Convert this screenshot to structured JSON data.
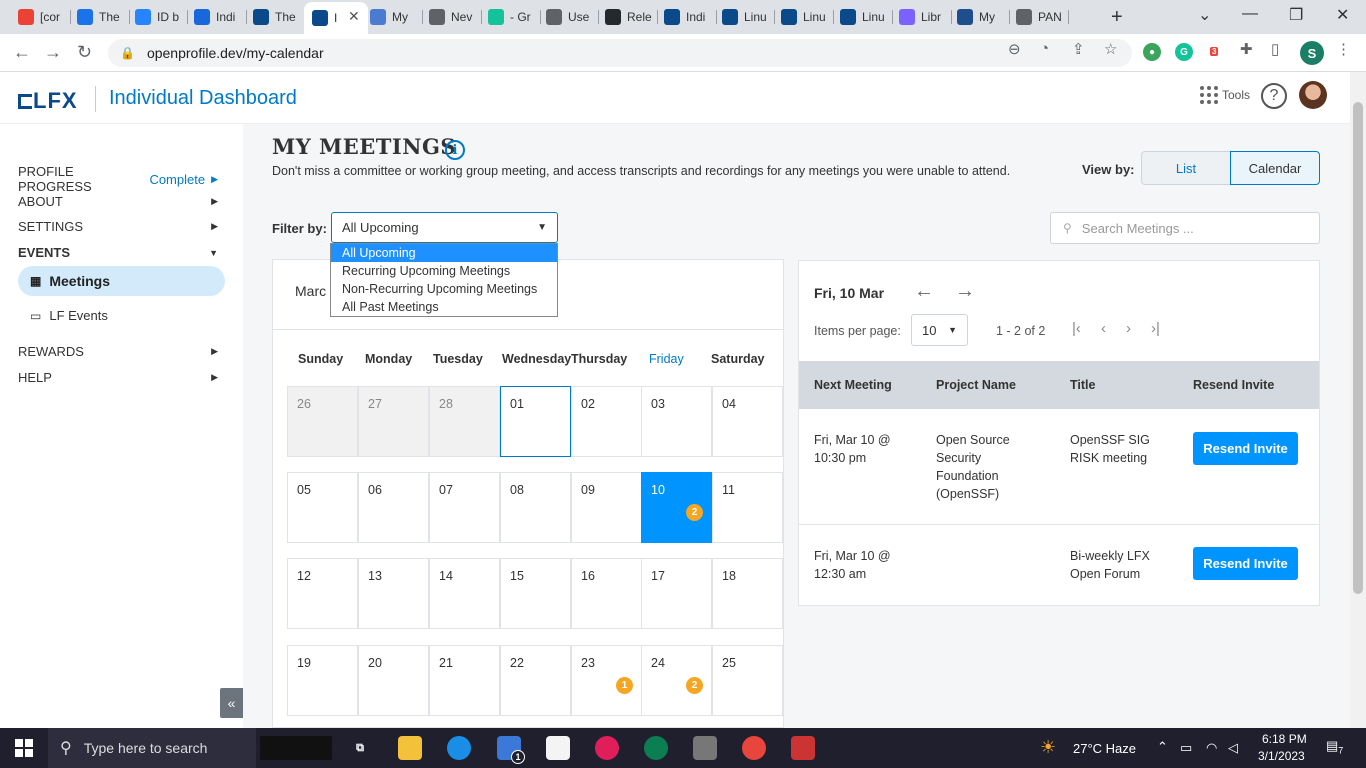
{
  "browser": {
    "tabs": [
      {
        "label": "[cor",
        "icon": "gmail-icon",
        "color": "#ea4335"
      },
      {
        "label": "The",
        "icon": "calendar-icon",
        "color": "#1a73e8"
      },
      {
        "label": "ID b",
        "icon": "jira-icon",
        "color": "#2684ff"
      },
      {
        "label": "Indi",
        "icon": "confluence-icon",
        "color": "#1868db"
      },
      {
        "label": "The",
        "icon": "lfx-icon",
        "color": "#0a4a8a"
      },
      {
        "label": "I",
        "icon": "lfx-icon",
        "color": "#0a4a8a"
      },
      {
        "label": "My",
        "icon": "layers-icon",
        "color": "#4a7bd0"
      },
      {
        "label": "Nev",
        "icon": "chromium-icon",
        "color": "#5f6368"
      },
      {
        "label": "- Gr",
        "icon": "grammarly-icon",
        "color": "#15c39a"
      },
      {
        "label": "Use",
        "icon": "globe-icon",
        "color": "#5f6368"
      },
      {
        "label": "Rele",
        "icon": "github-icon",
        "color": "#24292e"
      },
      {
        "label": "Indi",
        "icon": "lfx-icon",
        "color": "#0a4a8a"
      },
      {
        "label": "Linu",
        "icon": "lfx-icon",
        "color": "#0a4a8a"
      },
      {
        "label": "Linu",
        "icon": "lfx-icon",
        "color": "#0a4a8a"
      },
      {
        "label": "Linu",
        "icon": "lfx-icon",
        "color": "#0a4a8a"
      },
      {
        "label": "Libr",
        "icon": "flower-icon",
        "color": "#7b61ff"
      },
      {
        "label": "My",
        "icon": "app-icon",
        "color": "#1f4e8c"
      },
      {
        "label": "PAN",
        "icon": "globe-icon",
        "color": "#5f6368"
      }
    ],
    "url": "openprofile.dev/my-calendar",
    "extension_badge": "3",
    "profile_initial": "S"
  },
  "header": {
    "logo": "LFX",
    "title": "Individual Dashboard",
    "tools_label": "Tools",
    "help_glyph": "?"
  },
  "sidebar": {
    "profile_progress": "PROFILE PROGRESS",
    "complete": "Complete",
    "items": [
      {
        "label": "ABOUT"
      },
      {
        "label": "SETTINGS"
      },
      {
        "label": "EVENTS"
      },
      {
        "label": "REWARDS"
      },
      {
        "label": "HELP"
      }
    ],
    "meetings": "Meetings",
    "lf_events": "LF Events",
    "collapse": "«"
  },
  "main": {
    "title": "MY MEETINGS",
    "info_glyph": "i",
    "subtitle": "Don't miss a committee or working group meeting, and access transcripts and recordings for any meetings you were unable to attend.",
    "view_by": "View by:",
    "view_list": "List",
    "view_calendar": "Calendar",
    "filter_by": "Filter by:",
    "filter_value": "All Upcoming",
    "search_placeholder": "Search Meetings ...",
    "dropdown_options": [
      "All Upcoming",
      "Recurring Upcoming Meetings",
      "Non-Recurring Upcoming Meetings",
      "All Past Meetings"
    ]
  },
  "calendar": {
    "month": "Marc",
    "days_of_week": [
      "Sunday",
      "Monday",
      "Tuesday",
      "Wednesday",
      "Thursday",
      "Friday",
      "Saturday"
    ],
    "weeks": [
      [
        {
          "d": "26",
          "m": true
        },
        {
          "d": "27",
          "m": true
        },
        {
          "d": "28",
          "m": true
        },
        {
          "d": "01",
          "today": true
        },
        {
          "d": "02"
        },
        {
          "d": "03"
        },
        {
          "d": "04"
        }
      ],
      [
        {
          "d": "05"
        },
        {
          "d": "06"
        },
        {
          "d": "07"
        },
        {
          "d": "08"
        },
        {
          "d": "09"
        },
        {
          "d": "10",
          "sel": true,
          "badge": "2"
        },
        {
          "d": "11"
        }
      ],
      [
        {
          "d": "12"
        },
        {
          "d": "13"
        },
        {
          "d": "14"
        },
        {
          "d": "15"
        },
        {
          "d": "16"
        },
        {
          "d": "17"
        },
        {
          "d": "18"
        }
      ],
      [
        {
          "d": "19"
        },
        {
          "d": "20"
        },
        {
          "d": "21"
        },
        {
          "d": "22"
        },
        {
          "d": "23",
          "badge": "1"
        },
        {
          "d": "24",
          "badge": "2"
        },
        {
          "d": "25"
        }
      ]
    ]
  },
  "meeting_list": {
    "date": "Fri, 10 Mar",
    "items_per_page_label": "Items per page:",
    "items_per_page": "10",
    "range": "1 - 2 of 2",
    "headers": [
      "Next Meeting",
      "Project Name",
      "Title",
      "Resend Invite"
    ],
    "rows": [
      {
        "next": "Fri, Mar 10 @\n10:30 pm",
        "project": "Open Source\nSecurity\nFoundation\n(OpenSSF)",
        "title": "OpenSSF SIG\nRISK meeting",
        "action": "Resend Invite"
      },
      {
        "next": "Fri, Mar 10 @\n12:30 am",
        "project": "",
        "title": "Bi-weekly LFX\nOpen Forum",
        "action": "Resend Invite"
      }
    ]
  },
  "taskbar": {
    "search_placeholder": "Type here to search",
    "mail_badge": "1",
    "weather": "27°C  Haze",
    "time": "6:18 PM",
    "date": "3/1/2023",
    "notif_count": "7"
  }
}
